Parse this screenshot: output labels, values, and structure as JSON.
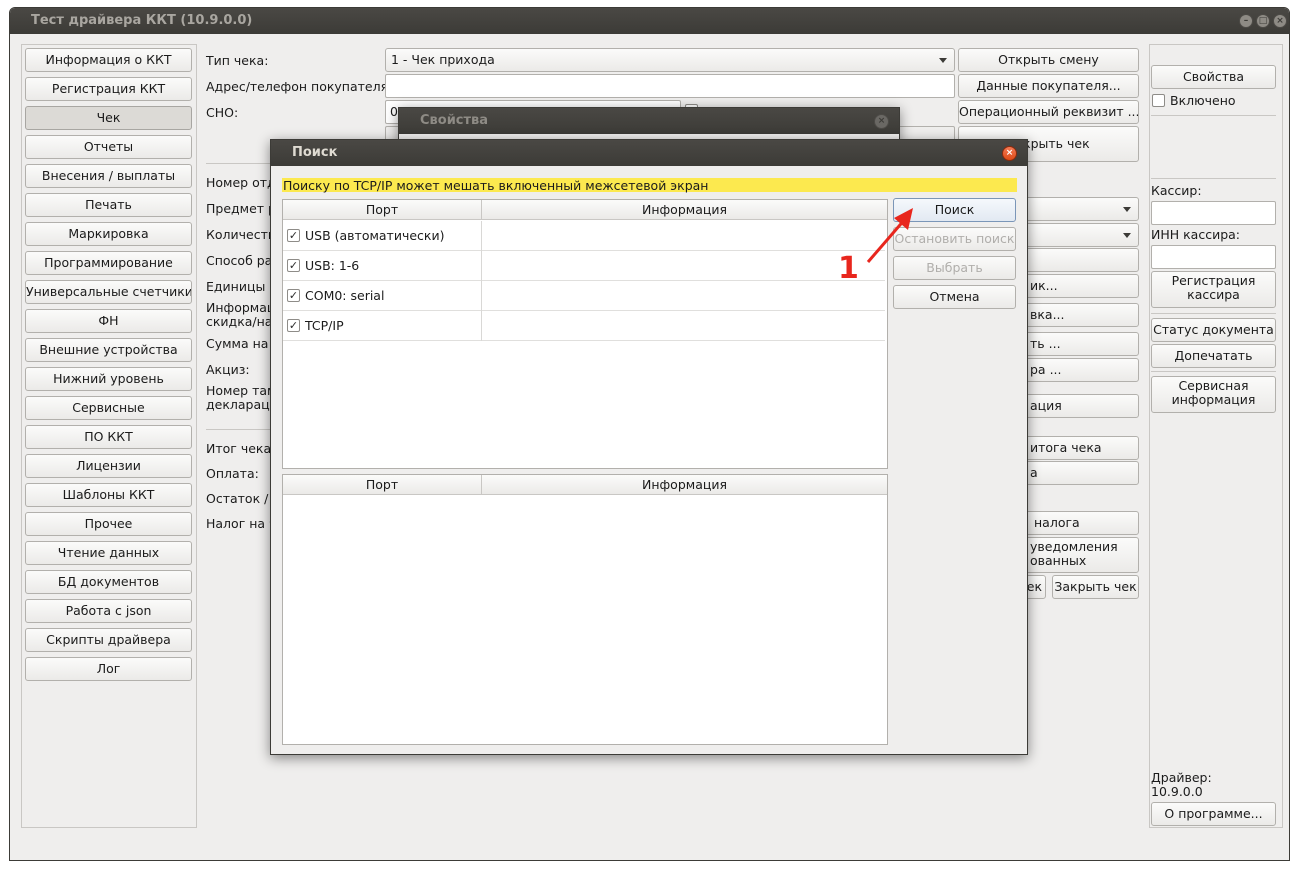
{
  "window": {
    "title": "Тест драйвера ККТ (10.9.0.0)"
  },
  "sidebar": {
    "items": [
      "Информация о ККТ",
      "Регистрация ККТ",
      "Чек",
      "Отчеты",
      "Внесения / выплаты",
      "Печать",
      "Маркировка",
      "Программирование",
      "Универсальные счетчики",
      "ФН",
      "Внешние устройства",
      "Нижний уровень",
      "Сервисные",
      "ПО ККТ",
      "Лицензии",
      "Шаблоны ККТ",
      "Прочее",
      "Чтение данных",
      "БД документов",
      "Работа с json",
      "Скрипты драйвера",
      "Лог"
    ],
    "selected_index": 2
  },
  "form": {
    "receipt_type_label": "Тип чека:",
    "receipt_type_value": "1 - Чек прихода",
    "buyer_address_label": "Адрес/телефон покупателя:",
    "sno_label": "СНО:",
    "sno_value": "0",
    "dept_label": "Номер отд",
    "subject_label": "Предмет р",
    "qty_label": "Количеств",
    "method_label": "Способ ра",
    "units_label": "Единицы и",
    "info_label_1": "Информац",
    "info_label_2": "скидка/на",
    "tax_sum_label": "Сумма на",
    "excise_label": "Акциз:",
    "customs_label_1": "Номер там",
    "customs_label_2": "декларац",
    "total_label": "Итог чека,",
    "payment_label": "Оплата:",
    "rest_label": "Остаток / С",
    "tax_on_label": "Налог на ч"
  },
  "right_buttons": {
    "open_shift": "Открыть смену",
    "buyer_data": "Данные покупателя...",
    "operational_req": "Операционный реквизит ...",
    "close_receipt_top": "Закрыть чек",
    "b_ik": "ик...",
    "b_vka": "вка...",
    "b_t": "ть ...",
    "b_ra": "ра ...",
    "b_ation": "ация",
    "total_receipt": "итога чека",
    "b_a": "а",
    "tax": "налога",
    "notif_1": "уведомления",
    "notif_2": "ованных товаров",
    "b_ek": "ек",
    "close_receipt": "Закрыть чек"
  },
  "right_panel": {
    "properties": "Свойства",
    "enabled": "Включено",
    "cashier_label": "Кассир:",
    "cashier_inn_label": "ИНН кассира:",
    "register_cashier": "Регистрация кассира",
    "doc_status": "Статус документа",
    "reprint": "Допечатать",
    "service_info": "Сервисная информация",
    "driver_label": "Драйвер:",
    "driver_version": "10.9.0.0",
    "about": "О программе..."
  },
  "properties_dialog": {
    "title": "Свойства"
  },
  "search_dialog": {
    "title": "Поиск",
    "warning": "Поиску по TCP/IP может мешать включенный межсетевой экран",
    "col_port": "Порт",
    "col_info": "Информация",
    "ports": [
      {
        "label": "USB (автоматически)",
        "checked": true
      },
      {
        "label": "USB: 1-6",
        "checked": true
      },
      {
        "label": "COM0: serial",
        "checked": true
      },
      {
        "label": "TCP/IP",
        "checked": true
      }
    ],
    "search_btn": "Поиск",
    "stop_btn": "Остановить поиск",
    "select_btn": "Выбрать",
    "cancel_btn": "Отмена"
  },
  "annotation": {
    "number": "1",
    "color": "#e8261d"
  }
}
